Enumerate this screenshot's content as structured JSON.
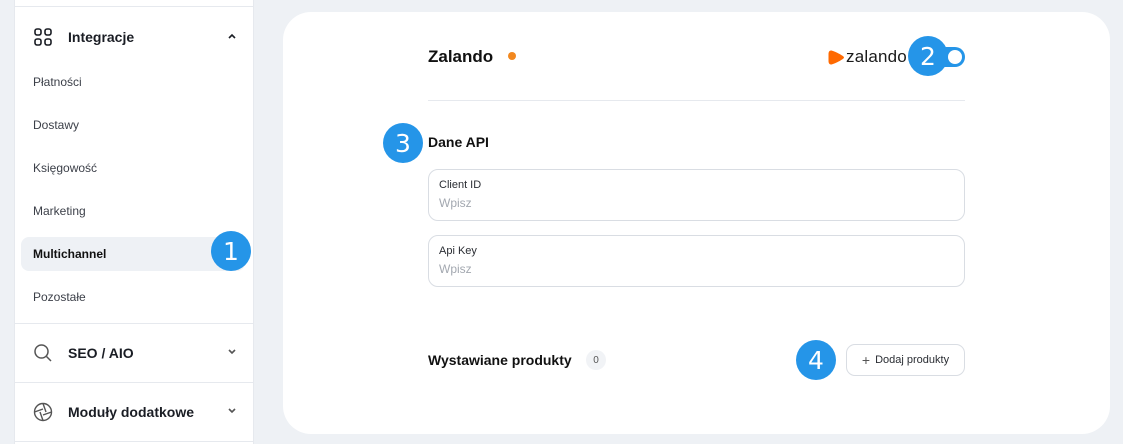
{
  "sidebar": {
    "integrations": {
      "label": "Integracje",
      "icon": "grid-icon",
      "expanded": true
    },
    "items": [
      {
        "label": "Płatności"
      },
      {
        "label": "Dostawy"
      },
      {
        "label": "Księgowość"
      },
      {
        "label": "Marketing"
      },
      {
        "label": "Multichannel",
        "active": true
      },
      {
        "label": "Pozostałe"
      }
    ],
    "seo": {
      "label": "SEO / AIO",
      "icon": "search-icon"
    },
    "modules": {
      "label": "Moduły dodatkowe",
      "icon": "aperture-icon"
    }
  },
  "badges": [
    "1",
    "2",
    "3",
    "4"
  ],
  "integration": {
    "title": "Zalando",
    "status_color": "#f2881f",
    "logo_text": "zalando",
    "logo_color": "#ff6900",
    "enabled": true
  },
  "api": {
    "title": "Dane API",
    "client_id": {
      "label": "Client ID",
      "placeholder": "Wpisz",
      "value": ""
    },
    "api_key": {
      "label": "Api Key",
      "placeholder": "Wpisz",
      "value": ""
    }
  },
  "products": {
    "title": "Wystawiane produkty",
    "count": "0",
    "add_label": "Dodaj produkty"
  },
  "colors": {
    "accent": "#2595e8",
    "background": "#eef1f5"
  }
}
